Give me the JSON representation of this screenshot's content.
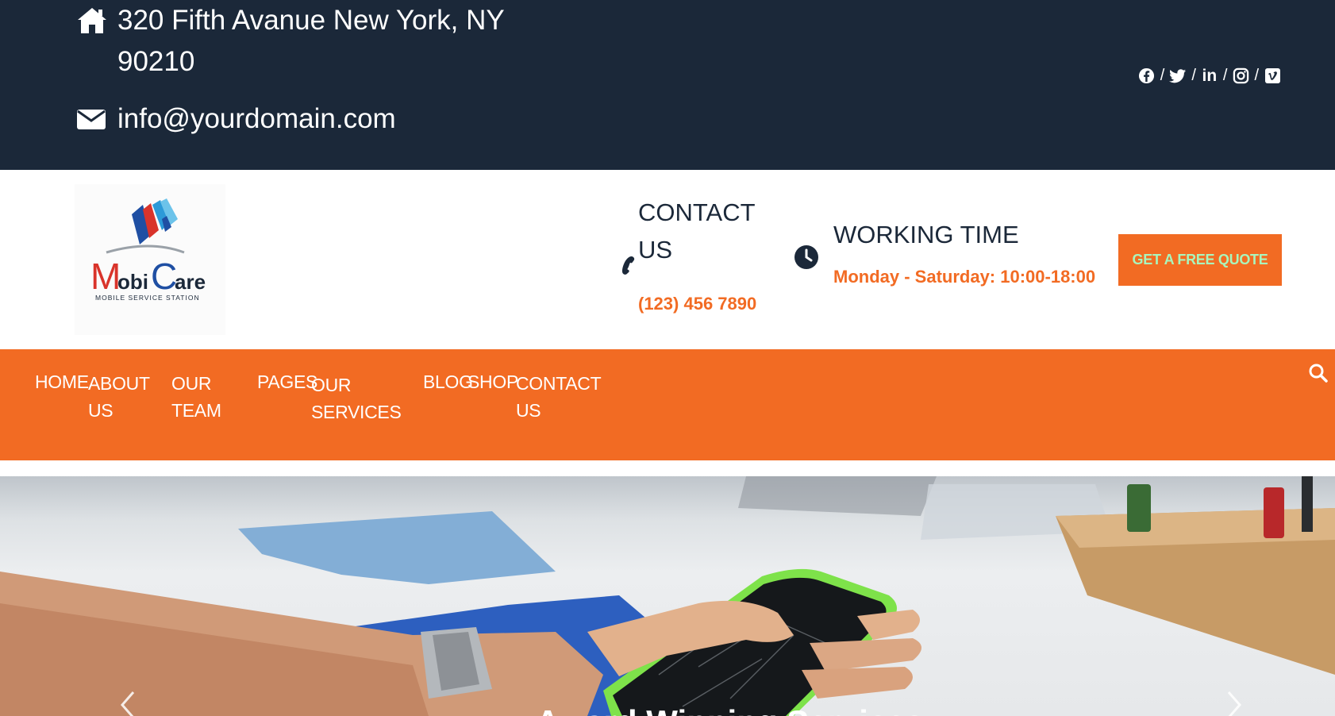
{
  "topbar": {
    "address": "320 Fifth Avanue New York, NY 90210",
    "email": "info@yourdomain.com",
    "address_icon": "home-icon",
    "email_icon": "envelope-icon",
    "social": [
      "facebook-icon",
      "twitter-icon",
      "linkedin-icon",
      "instagram-icon",
      "vimeo-icon"
    ],
    "separator": "/",
    "linkedin_glyph": "in"
  },
  "header": {
    "logo_text": "MobiCare",
    "logo_text_part1": "obi",
    "logo_text_part2": "are",
    "logo_tagline": "MOBILE SERVICE STATION",
    "contact_title": "CONTACT US",
    "contact_phone": "(123) 456 7890",
    "working_title": "WORKING TIME",
    "working_hours": "Monday - Saturday: 10:00-18:00",
    "quote_button": "GET A FREE QUOTE"
  },
  "nav": {
    "items": [
      {
        "label": "HOME"
      },
      {
        "label": "ABOUT US"
      },
      {
        "label": "OUR TEAM"
      },
      {
        "label": "PAGES"
      },
      {
        "label": "OUR SERVICES"
      },
      {
        "label": "BLOG"
      },
      {
        "label": "SHOP"
      },
      {
        "label": "CONTACT US"
      }
    ],
    "search_icon": "search-icon"
  },
  "hero": {
    "caption": "Award Winning Services",
    "prev_icon": "chevron-left-icon",
    "next_icon": "chevron-right-icon"
  },
  "colors": {
    "topbar_bg": "#1b2839",
    "accent": "#f26b23",
    "button_text": "#a9f5bc"
  }
}
